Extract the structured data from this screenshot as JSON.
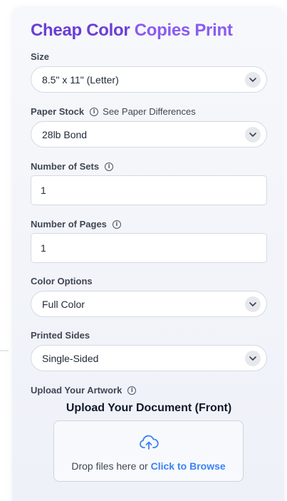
{
  "title": {
    "part1": "Cheap Color",
    "part2": "Copies Print"
  },
  "size": {
    "label": "Size",
    "value": "8.5\" x 11\" (Letter)"
  },
  "paper_stock": {
    "label": "Paper Stock",
    "link": "See Paper Differences",
    "value": "28lb Bond"
  },
  "number_of_sets": {
    "label": "Number of Sets",
    "value": "1"
  },
  "number_of_pages": {
    "label": "Number of Pages",
    "value": "1"
  },
  "color_options": {
    "label": "Color Options",
    "value": "Full Color"
  },
  "printed_sides": {
    "label": "Printed Sides",
    "value": "Single-Sided"
  },
  "upload": {
    "label": "Upload Your Artwork",
    "heading": "Upload Your Document (Front)",
    "drop_text": "Drop files here or",
    "browse_text": "Click to Browse"
  },
  "icons": {
    "info": "info-icon",
    "chevron": "chevron-down-icon",
    "upload": "cloud-upload-icon"
  },
  "colors": {
    "title_primary": "#6a3fd4",
    "title_secondary": "#8a5cf0",
    "link": "#3b82f6"
  }
}
